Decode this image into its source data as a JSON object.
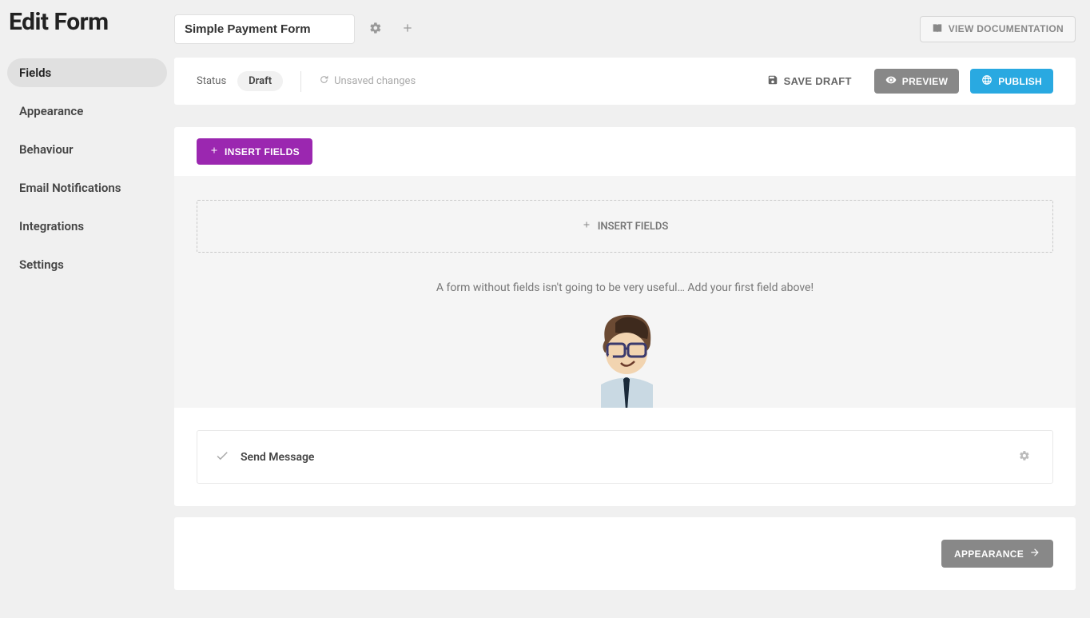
{
  "page_title": "Edit Form",
  "form_name": "Simple Payment Form",
  "header": {
    "view_docs": "VIEW DOCUMENTATION"
  },
  "sidebar": {
    "items": [
      {
        "label": "Fields",
        "active": true
      },
      {
        "label": "Appearance",
        "active": false
      },
      {
        "label": "Behaviour",
        "active": false
      },
      {
        "label": "Email Notifications",
        "active": false
      },
      {
        "label": "Integrations",
        "active": false
      },
      {
        "label": "Settings",
        "active": false
      }
    ]
  },
  "statusbar": {
    "status_label": "Status",
    "status_value": "Draft",
    "unsaved": "Unsaved changes",
    "save_draft": "SAVE DRAFT",
    "preview": "PREVIEW",
    "publish": "PUBLISH"
  },
  "canvas": {
    "insert_fields": "INSERT FIELDS",
    "drop_label": "INSERT FIELDS",
    "empty_text": "A form without fields isn't going to be very useful… Add your first field above!"
  },
  "submit": {
    "label": "Send Message"
  },
  "footer": {
    "appearance": "APPEARANCE"
  }
}
